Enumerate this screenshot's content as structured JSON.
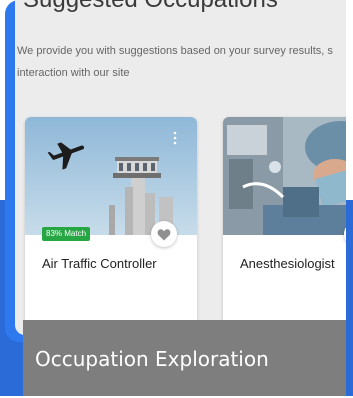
{
  "page": {
    "title": "Suggested Occupations",
    "subtitle": "We provide you with suggestions based on your survey results, s interaction with our site"
  },
  "cards": [
    {
      "name": "Air Traffic Controller",
      "match_badge": "83% Match",
      "match_percent": 83,
      "image_icon": "airplane-tower-photo",
      "favorite_icon": "heart-icon"
    },
    {
      "name": "Anesthesiologist",
      "image_icon": "surgery-photo",
      "favorite_icon": "heart-icon"
    }
  ],
  "caption": "Occupation Exploration",
  "colors": {
    "frame_blue": "#2f79ef",
    "band_blue": "#2a6bd8",
    "match_green": "#27a644",
    "caption_gray": "#7e7e7e"
  }
}
